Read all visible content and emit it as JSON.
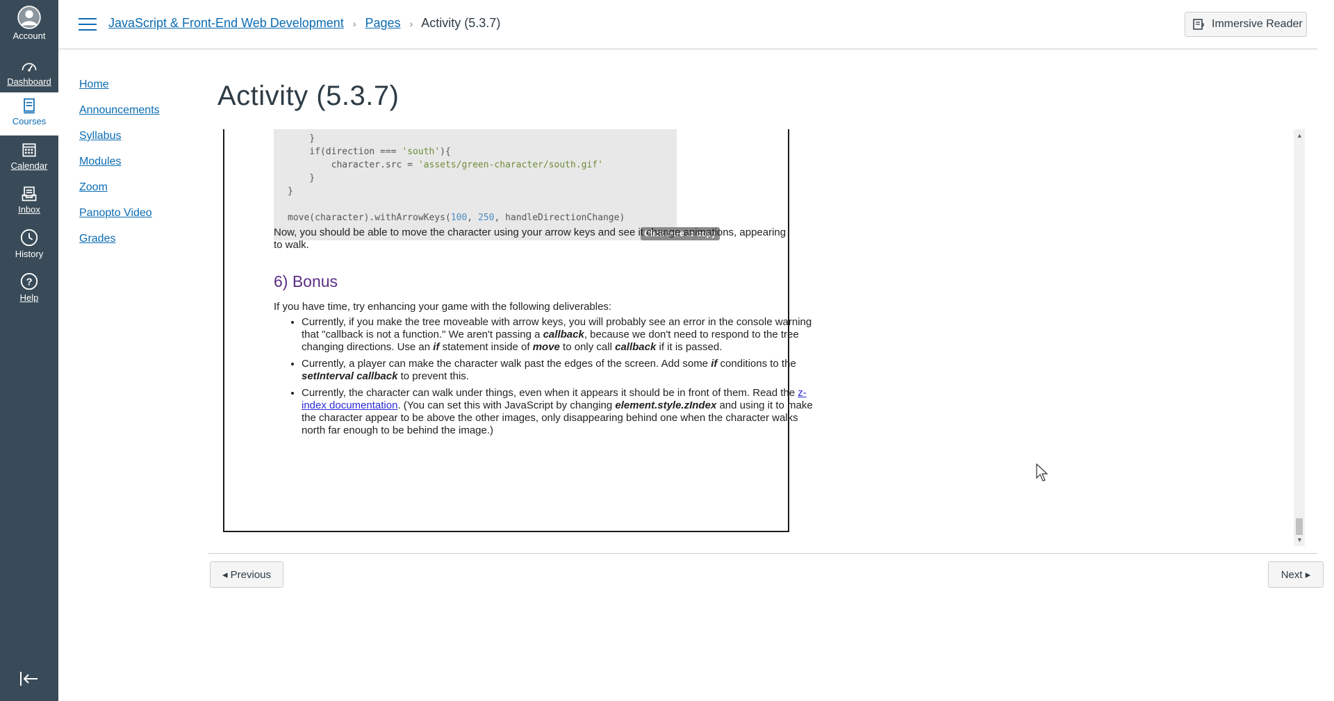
{
  "global_nav": {
    "items": [
      {
        "label": "Account",
        "icon": "account-icon"
      },
      {
        "label": "Dashboard",
        "icon": "dashboard-icon"
      },
      {
        "label": "Courses",
        "icon": "courses-icon"
      },
      {
        "label": "Calendar",
        "icon": "calendar-icon"
      },
      {
        "label": "Inbox",
        "icon": "inbox-icon"
      },
      {
        "label": "History",
        "icon": "history-icon"
      },
      {
        "label": "Help",
        "icon": "help-icon"
      }
    ],
    "bg_color": "#394b58"
  },
  "header": {
    "breadcrumb": [
      "JavaScript & Front-End Web Development",
      "Pages",
      "Activity (5.3.7)"
    ],
    "immersive_reader": "Immersive Reader"
  },
  "course_nav": [
    "Home",
    "Announcements",
    "Syllabus",
    "Modules",
    "Zoom",
    "Panopto Video",
    "Grades"
  ],
  "page_title": "Activity (5.3.7)",
  "content": {
    "code_lines": [
      "    }",
      "    if(direction === 'south'){",
      "        character.src = 'assets/green-character/south.gif'",
      "    }",
      "}",
      "",
      "move(character).withArrowKeys(100, 250, handleDirectionChange)"
    ],
    "copy_label": "Click here to copy",
    "after_code": "Now, you should be able to move the character using your arrow keys and see it change animations, appearing to walk.",
    "bonus_heading": "6) Bonus",
    "bonus_intro": "If you have time, try enhancing your game with the following deliverables:",
    "bullet1": {
      "a": "Currently, if you make the tree moveable with arrow keys, you will probably see an error in the console warning that \"callback is not a function.\" We aren't passing a ",
      "b": "callback",
      "c": ", because we don't need to respond to the tree changing directions. Use an ",
      "d": "if",
      "e": " statement inside of ",
      "f": "move",
      "g": " to only call ",
      "h": "callback",
      "i": " if it is passed."
    },
    "bullet2": {
      "a": "Currently, a player can make the character walk past the edges of the screen. Add some ",
      "b": "if",
      "c": " conditions to the ",
      "d": "setInterval callback",
      "e": " to prevent this."
    },
    "bullet3": {
      "a": "Currently, the character can walk under things, even when it appears it should be in front of them. Read the ",
      "link": "z-index documentation",
      "b": ". (You can set this with JavaScript by changing ",
      "c": "element.style.zIndex",
      "d": " and using it to make the character appear to be above the other images, only disappearing behind one when the character walks north far enough to be behind the image.)"
    }
  },
  "footer": {
    "previous": "◂ Previous",
    "next": "Next ▸"
  },
  "colors": {
    "link": "#0b6cb3",
    "bonus_heading": "#5b2d84",
    "code_bg": "#e8e8e8"
  }
}
